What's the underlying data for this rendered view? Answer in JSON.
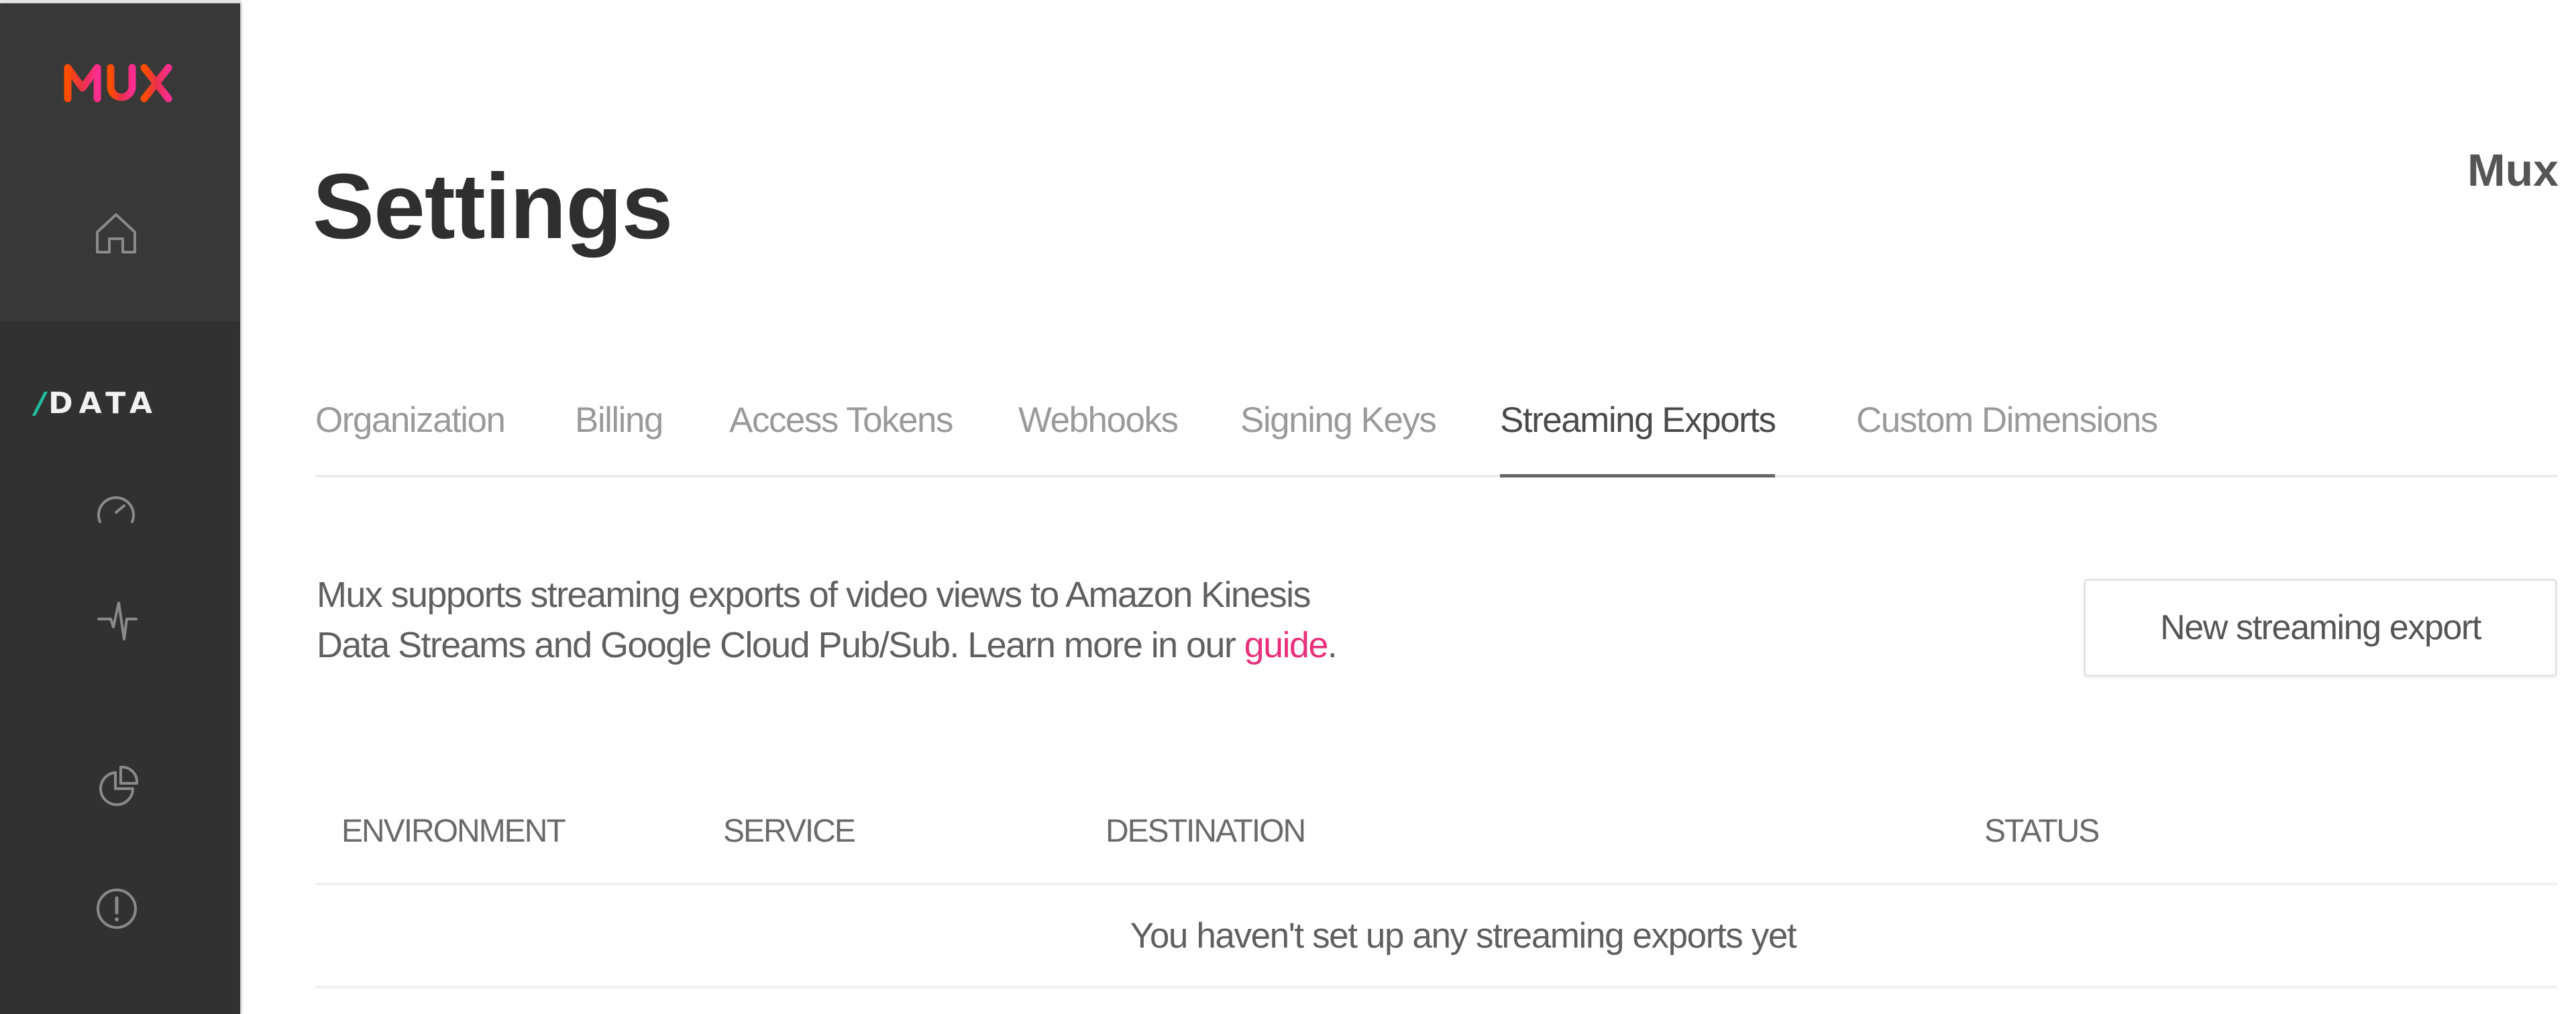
{
  "brand": {
    "logo_text": "MUX",
    "logo_colors": [
      "#ff4e00",
      "#e8304a",
      "#ff2d8f"
    ],
    "product_slash": "/",
    "product_name": "DATA",
    "product_accent": "#1fbfa0"
  },
  "sidebar": {
    "items": [
      {
        "name": "home",
        "icon": "home-icon"
      },
      {
        "name": "metrics",
        "icon": "gauge-icon"
      },
      {
        "name": "monitoring",
        "icon": "pulse-icon"
      },
      {
        "name": "breakdowns",
        "icon": "pie-chart-icon"
      },
      {
        "name": "errors",
        "icon": "alert-circle-icon"
      }
    ]
  },
  "header": {
    "title": "Settings",
    "org_name": "Mux"
  },
  "tabs": [
    {
      "label": "Organization",
      "active": false
    },
    {
      "label": "Billing",
      "active": false
    },
    {
      "label": "Access Tokens",
      "active": false
    },
    {
      "label": "Webhooks",
      "active": false
    },
    {
      "label": "Signing Keys",
      "active": false
    },
    {
      "label": "Streaming Exports",
      "active": true
    },
    {
      "label": "Custom Dimensions",
      "active": false
    }
  ],
  "streaming_exports": {
    "description_line1": "Mux supports streaming exports of video views to Amazon Kinesis",
    "description_line2": "Data Streams and Google Cloud Pub/Sub. Learn more in our ",
    "link_text": "guide",
    "description_end": ".",
    "link_color": "#e8307a",
    "new_button_label": "New streaming export",
    "table": {
      "columns": [
        "ENVIRONMENT",
        "SERVICE",
        "DESTINATION",
        "STATUS"
      ],
      "rows": [],
      "empty_message": "You haven't set up any streaming exports yet"
    }
  }
}
